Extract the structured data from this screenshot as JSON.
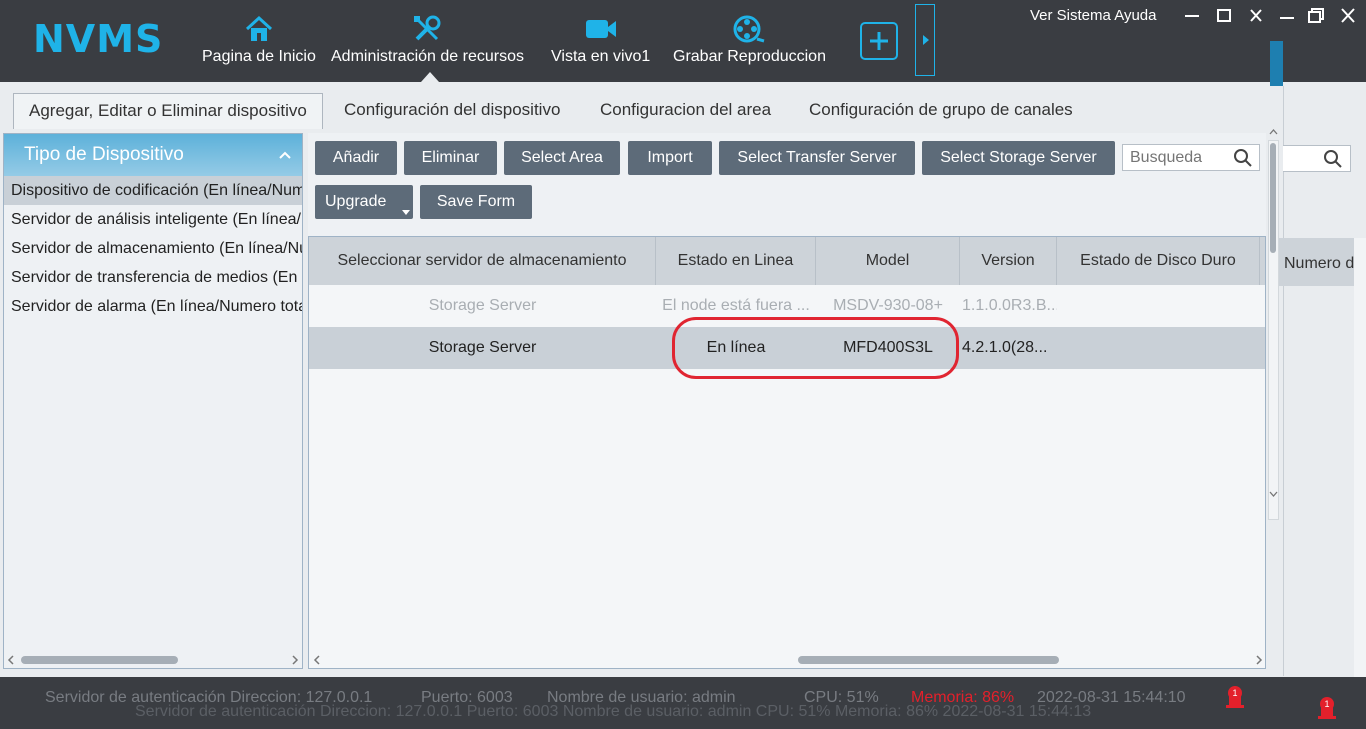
{
  "app": {
    "logo": "NVMS"
  },
  "nav": [
    {
      "label": "Pagina de Inicio",
      "icon": "home-icon"
    },
    {
      "label": "Administración de recursos",
      "icon": "tools-icon"
    },
    {
      "label": "Vista en vivo1",
      "icon": "video-camera-icon"
    },
    {
      "label": "Grabar Reproduccion",
      "icon": "film-reel-icon"
    }
  ],
  "menu": {
    "links": "Ver Sistema Ayuda"
  },
  "tabs": [
    {
      "label": "Agregar, Editar o Eliminar dispositivo"
    },
    {
      "label": "Configuración del dispositivo"
    },
    {
      "label": "Configuracion del area"
    },
    {
      "label": "Configuración de grupo de canales"
    }
  ],
  "left": {
    "title": "Tipo de Dispositivo",
    "items": [
      "Dispositivo de codificación (En línea/Numero total)",
      "Servidor de análisis inteligente (En línea/Numero total)",
      "Servidor de almacenamiento (En línea/Numero total)",
      "Servidor de transferencia de medios (En línea/Numero total)",
      "Servidor de alarma (En línea/Numero total)"
    ]
  },
  "toolbar": {
    "add": "Añadir",
    "delete": "Eliminar",
    "select_area": "Select Area",
    "import": "Import",
    "select_transfer": "Select Transfer Server",
    "select_storage": "Select Storage Server",
    "upgrade": "Upgrade",
    "save_form": "Save Form",
    "search_placeholder": "Busqueda"
  },
  "table": {
    "columns": [
      "Seleccionar servidor de almacenamiento",
      "Estado en Linea",
      "Model",
      "Version",
      "Estado de Disco Duro",
      "Numero de"
    ],
    "rows": [
      [
        "Storage Server",
        "El node está fuera ...",
        "MSDV-930-08+",
        "1.1.0.0R3.B..."
      ],
      [
        "Storage Server",
        "En línea",
        "MFD400S3L",
        "4.2.1.0(28..."
      ]
    ]
  },
  "status": {
    "ghost": "Servidor de autenticación Direccion: 127.0.0.1    Puerto: 6003    Nombre de usuario: admin    CPU: 51%    Memoria: 86%    2022-08-31 15:44:13",
    "auth": "Servidor de autenticación Direccion: 127.0.0.1",
    "port": "Puerto: 6003",
    "user": "Nombre de usuario: admin",
    "cpu": "CPU: 51%",
    "memory": "Memoria: 86%",
    "datetime": "2022-08-31 15:44:10",
    "alarm_count": "1",
    "alarm_count2": "1"
  },
  "colors": {
    "accent": "#1fb3e8",
    "header": "#3a3d42",
    "button": "#5d6b79",
    "highlight": "#e02531",
    "warning": "#e3202b"
  }
}
